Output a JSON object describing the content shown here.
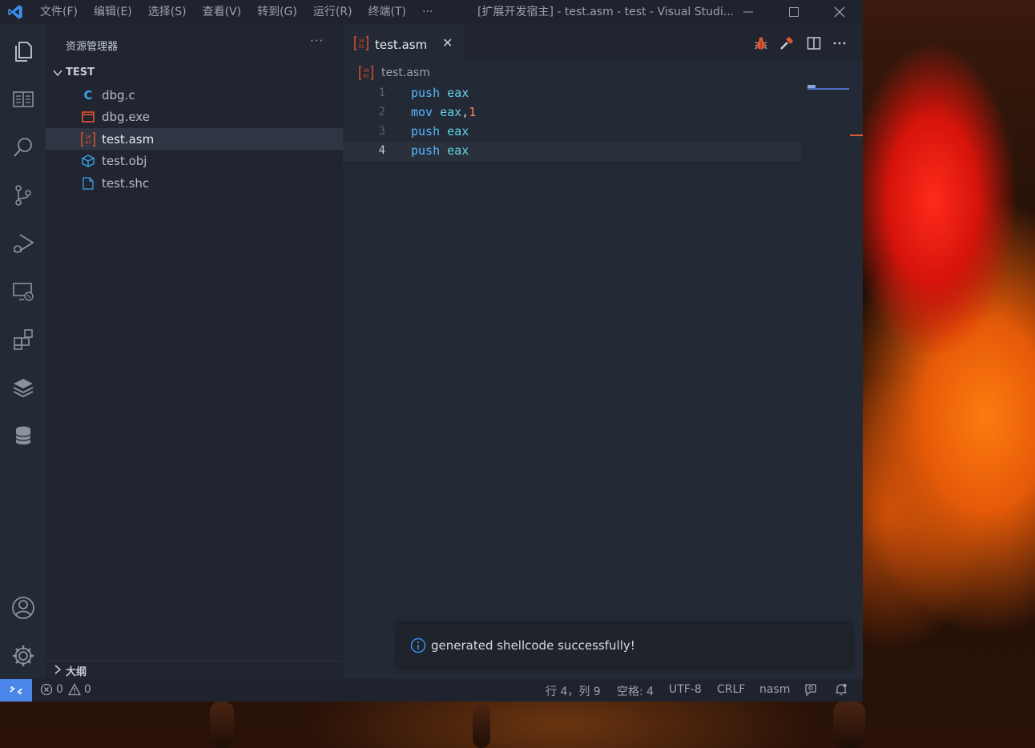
{
  "titlebar": {
    "menu": [
      "文件(F)",
      "编辑(E)",
      "选择(S)",
      "查看(V)",
      "转到(G)",
      "运行(R)",
      "终端(T)",
      "···"
    ],
    "title": "[扩展开发宿主] - test.asm - test - Visual Studi..."
  },
  "sidebar": {
    "title": "资源管理器",
    "more": "···",
    "folder": "TEST",
    "files": [
      {
        "name": "dbg.c",
        "icon": "c-file-icon"
      },
      {
        "name": "dbg.exe",
        "icon": "exe-file-icon"
      },
      {
        "name": "test.asm",
        "icon": "asm-file-icon"
      },
      {
        "name": "test.obj",
        "icon": "obj-file-icon"
      },
      {
        "name": "test.shc",
        "icon": "generic-file-icon"
      }
    ],
    "outline": "大纲"
  },
  "editor": {
    "tab_label": "test.asm",
    "tab_close": "✕",
    "breadcrumb": "test.asm",
    "lines": [
      {
        "n": "1",
        "op": "push",
        "a": "eax",
        "sep": "",
        "b": ""
      },
      {
        "n": "2",
        "op": "mov",
        "a": "eax",
        "sep": ",",
        "b": "1"
      },
      {
        "n": "3",
        "op": "push",
        "a": "eax",
        "sep": "",
        "b": ""
      },
      {
        "n": "4",
        "op": "push",
        "a": "eax",
        "sep": "",
        "b": ""
      }
    ],
    "current_line": 4
  },
  "notification": {
    "message": "generated shellcode successfully!"
  },
  "statusbar": {
    "errors": "0",
    "warnings": "0",
    "position": "行 4，列 9",
    "spaces": "空格: 4",
    "encoding": "UTF-8",
    "eol": "CRLF",
    "language": "nasm"
  },
  "colors": {
    "accent": "#4a86e8",
    "keyword": "#56b6ff",
    "register": "#62d3e6",
    "number": "#ff8552"
  }
}
